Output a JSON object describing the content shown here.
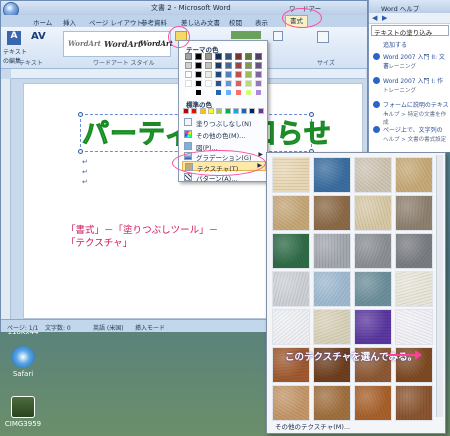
{
  "window": {
    "title": "文書 2 - Microsoft Word",
    "contextual_tab_label": "ワードアー"
  },
  "tabs": [
    "ホーム",
    "挿入",
    "ページ レイアウト",
    "参考資料",
    "差し込み文書",
    "校閲",
    "表示",
    "書式"
  ],
  "ribbon": {
    "edit_text_label": "テキストの編集",
    "text_group_label": "テキスト",
    "wordart_group_label": "ワードアート スタイル",
    "size_label": "サイズ",
    "wordart_samples": [
      "WordArt",
      "WordArt",
      "WordArt"
    ]
  },
  "fill_menu": {
    "theme_colors_label": "テーマの色",
    "standard_colors_label": "標準の色",
    "items": [
      "塗りつぶしなし(N)",
      "その他の色(M)...",
      "図(P)...",
      "グラデーション(G)",
      "テクスチャ(T)",
      "パターン(A)..."
    ],
    "theme_colors": [
      "#ffffff",
      "#000000",
      "#eeece1",
      "#1f497d",
      "#4f81bd",
      "#c0504d",
      "#9bbb59",
      "#8064a2"
    ],
    "standard_colors": [
      "#c00000",
      "#ff0000",
      "#ffc000",
      "#ffff00",
      "#92d050",
      "#00b050",
      "#00b0f0",
      "#0070c0",
      "#002060",
      "#7030a0"
    ]
  },
  "document": {
    "wordart_text": "パーティのお知らせ",
    "instruction": "「書式」－「塗りつぶしツール」－\n「テクスチャ」"
  },
  "status_bar": {
    "page": "ページ: 1/1",
    "words": "文字数: 0",
    "language": "英語 (米国)",
    "mode": "挿入モード"
  },
  "texture_panel": {
    "more_label": "その他のテクスチャ(M)...",
    "callout": "このテクスチャを選んでみる。",
    "textures": [
      [
        "#e8d7b4",
        "#3b6ea0",
        "#cfc5b4",
        "#c7aa78"
      ],
      [
        "#c6a778",
        "#8c6a46",
        "#d8c9a6",
        "#8f8170"
      ],
      [
        "#2f6b46",
        "#a3a7ae",
        "#8c8f95",
        "#7a7d82"
      ],
      [
        "#cdd1d7",
        "#9fbad1",
        "#6d8f9c",
        "#e8e6d9"
      ],
      [
        "#eef0f4",
        "#d9d2ba",
        "#5a38a0",
        "#f0f0f6"
      ],
      [
        "#9f5a30",
        "#6e3f1f",
        "#8d5a35",
        "#7d4a23"
      ],
      [
        "#c49769",
        "#a0703f",
        "#a8612b",
        "#8a5530"
      ]
    ]
  },
  "help_pane": {
    "title": "Word ヘルプ",
    "search_text": "テキストの塗り込み",
    "search_link": "追加する",
    "results": [
      {
        "title": "Word 2007 入門 II: 文書",
        "sub": "トレーニング"
      },
      {
        "title": "Word 2007 入門 I: 作",
        "sub": "トレーニング"
      },
      {
        "title": "フォームに説明のテキスト",
        "sub": "ヘルプ > 特定の文書を作成"
      },
      {
        "title": "ページ上で、文字列の",
        "sub": "ヘルプ > 文書の書式設定"
      }
    ]
  },
  "desktop": {
    "top_label": "118Kx44",
    "icons": [
      "Safari",
      "CIMG3959"
    ]
  }
}
